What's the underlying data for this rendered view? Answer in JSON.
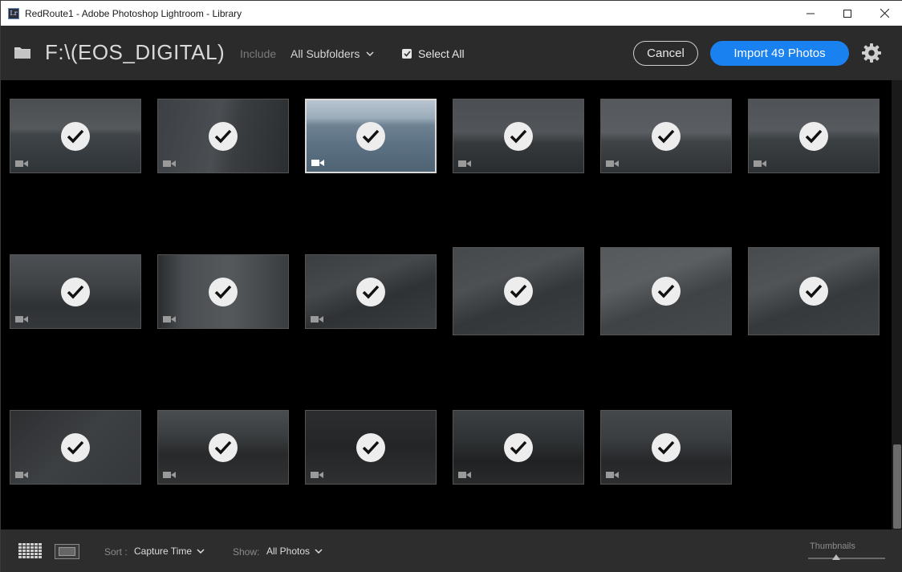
{
  "window": {
    "title": "RedRoute1 - Adobe Photoshop Lightroom - Library",
    "app_icon_text": "Lr"
  },
  "header": {
    "path": "F:\\(EOS_DIGITAL)",
    "include_label": "Include",
    "subfolders_label": "All Subfolders",
    "select_all_label": "Select All",
    "select_all_checked": true,
    "cancel_label": "Cancel",
    "import_label": "Import 49 Photos",
    "accent_color": "#1a82f0"
  },
  "thumbnails": [
    {
      "name": "city-skyline-river",
      "selected": false,
      "checked": true,
      "video": true
    },
    {
      "name": "riverside-walkway",
      "selected": false,
      "checked": true,
      "video": true
    },
    {
      "name": "harbor-boats-skyline",
      "selected": true,
      "checked": true,
      "video": true
    },
    {
      "name": "dusk-skyline-pier",
      "selected": false,
      "checked": true,
      "video": true
    },
    {
      "name": "river-shore-curve",
      "selected": false,
      "checked": true,
      "video": true
    },
    {
      "name": "distant-skyline",
      "selected": false,
      "checked": true,
      "video": true
    },
    {
      "name": "brick-buildings",
      "selected": false,
      "checked": true,
      "video": true
    },
    {
      "name": "smokestack-tower",
      "selected": false,
      "checked": true,
      "video": true
    },
    {
      "name": "roadway-guardrail",
      "selected": false,
      "checked": true,
      "video": true
    },
    {
      "name": "highway-trees",
      "selected": false,
      "checked": true,
      "video": true
    },
    {
      "name": "highway-rain",
      "selected": false,
      "checked": true,
      "video": true
    },
    {
      "name": "highway-cars",
      "selected": false,
      "checked": true,
      "video": true
    },
    {
      "name": "pavement-closeup",
      "selected": false,
      "checked": true,
      "video": true
    },
    {
      "name": "campus-arch",
      "selected": false,
      "checked": true,
      "video": true
    },
    {
      "name": "dark-road",
      "selected": false,
      "checked": true,
      "video": true
    },
    {
      "name": "night-canal",
      "selected": false,
      "checked": true,
      "video": true
    },
    {
      "name": "night-bridge",
      "selected": false,
      "checked": true,
      "video": true
    }
  ],
  "footer": {
    "sort_label": "Sort :",
    "sort_value": "Capture Time",
    "show_label": "Show:",
    "show_value": "All Photos",
    "thumbnails_label": "Thumbnails"
  }
}
